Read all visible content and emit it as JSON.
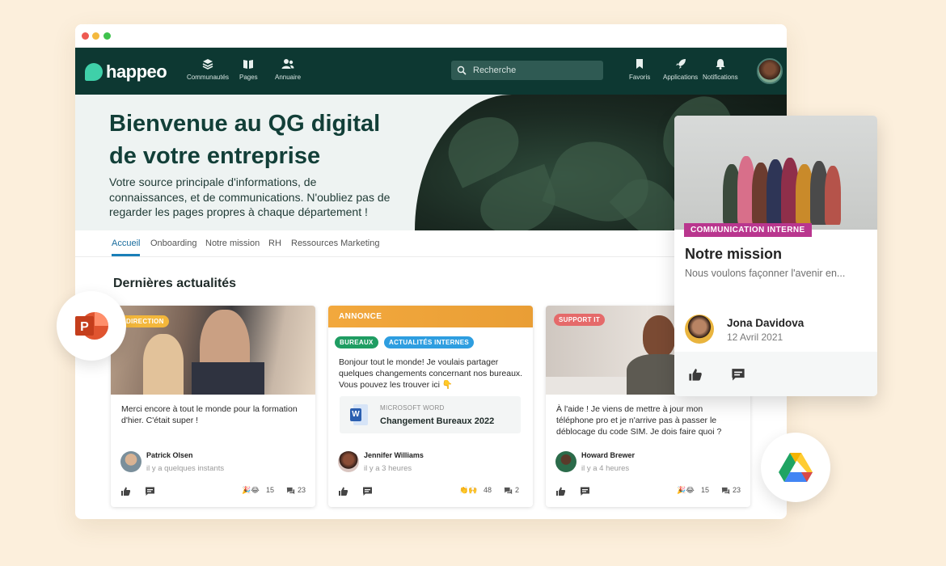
{
  "window": {
    "dots": [
      "close",
      "minimize",
      "maximize"
    ]
  },
  "nav": {
    "logo": "happeo",
    "items": [
      {
        "label": "Communautés",
        "icon": "layers-icon"
      },
      {
        "label": "Pages",
        "icon": "book-icon"
      },
      {
        "label": "Annuaire",
        "icon": "people-icon"
      }
    ],
    "search_placeholder": "Recherche",
    "right_items": [
      {
        "label": "Favoris",
        "icon": "bookmark-icon"
      },
      {
        "label": "Applications",
        "icon": "rocket-icon"
      },
      {
        "label": "Notifications",
        "icon": "bell-icon"
      }
    ]
  },
  "hero": {
    "title_line1": "Bienvenue au QG digital",
    "title_line2": "de votre entreprise",
    "text": "Votre source principale d'informations, de connaissances, et de communications. N'oubliez pas de regarder les pages propres à chaque département !"
  },
  "tabs": [
    "Accueil",
    "Onboarding",
    "Notre mission",
    "RH",
    "Ressources Marketing"
  ],
  "section_title": "Dernières actualités",
  "cards": [
    {
      "badge": "DIRECTION",
      "text": "Merci encore à tout le monde pour la formation d'hier. C'était super !",
      "author": "Patrick Olsen",
      "time": "il y a quelques instants",
      "reactions": "15",
      "comments": "23"
    },
    {
      "header": "ANNONCE",
      "tags": [
        "BUREAUX",
        "ACTUALITÉS INTERNES"
      ],
      "text": "Bonjour tout le monde! Je voulais partager quelques changements concernant nos bureaux. Vous pouvez les trouver ici 👇",
      "doc_type": "MICROSOFT WORD",
      "doc_title": "Changement Bureaux 2022",
      "author": "Jennifer Williams",
      "time": "il y a 3 heures",
      "reactions": "48",
      "comments": "2"
    },
    {
      "badge": "SUPPORT IT",
      "text": "À l'aide ! Je viens de mettre à jour mon téléphone pro et je n'arrive pas à passer le déblocage du code SIM. Je dois faire quoi ?",
      "author": "Howard Brewer",
      "time": "il y a 4 heures",
      "reactions": "15",
      "comments": "23"
    }
  ],
  "float_card": {
    "badge": "COMMUNICATION INTERNE",
    "title": "Notre mission",
    "subtitle": "Nous voulons façonner l'avenir en...",
    "author": "Jona Davidova",
    "date": "12 Avril 2021"
  },
  "colors": {
    "page_bg": "#fcefdc",
    "nav_bg": "#0d3832",
    "accent": "#1a7fb8",
    "annonce": "#f0a53a",
    "tag_green": "#1f9d62",
    "tag_blue": "#2e9ee0",
    "badge_pink": "#b9368e"
  }
}
